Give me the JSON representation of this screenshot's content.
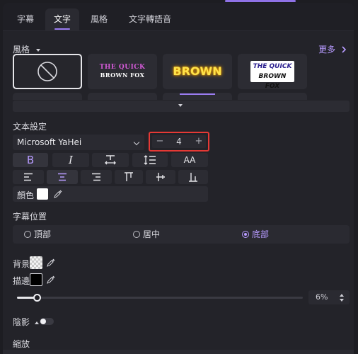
{
  "tabs": [
    {
      "label": "字幕"
    },
    {
      "label": "文字"
    },
    {
      "label": "風格"
    },
    {
      "label": "文字轉語音"
    }
  ],
  "style_section": {
    "label": "風格",
    "more_label": "更多",
    "presets": [
      {
        "name": "none"
      },
      {
        "line1": "THE QUICK",
        "line2": "BROWN FOX"
      },
      {
        "text": "BROWN"
      },
      {
        "line1": "THE QUICK",
        "line2": "BROWN FOX"
      }
    ]
  },
  "text_settings": {
    "label": "文本設定",
    "font_family": "Microsoft YaHei",
    "size_minus": "−",
    "size_value": "4",
    "size_plus": "+",
    "caps_label": "AA",
    "color_label": "顏色"
  },
  "caption_position": {
    "label": "字幕位置",
    "options": [
      "頂部",
      "居中",
      "底部"
    ],
    "selected": "底部"
  },
  "background": {
    "label": "背景"
  },
  "stroke": {
    "label": "描邊",
    "percent": "6%",
    "slider_fraction": 0.07
  },
  "shadow": {
    "label": "陰影"
  },
  "zoom": {
    "label": "縮放"
  },
  "colors": {
    "accent": "#9b7cf2",
    "highlight_red": "#e53935",
    "panel": "#232329"
  }
}
